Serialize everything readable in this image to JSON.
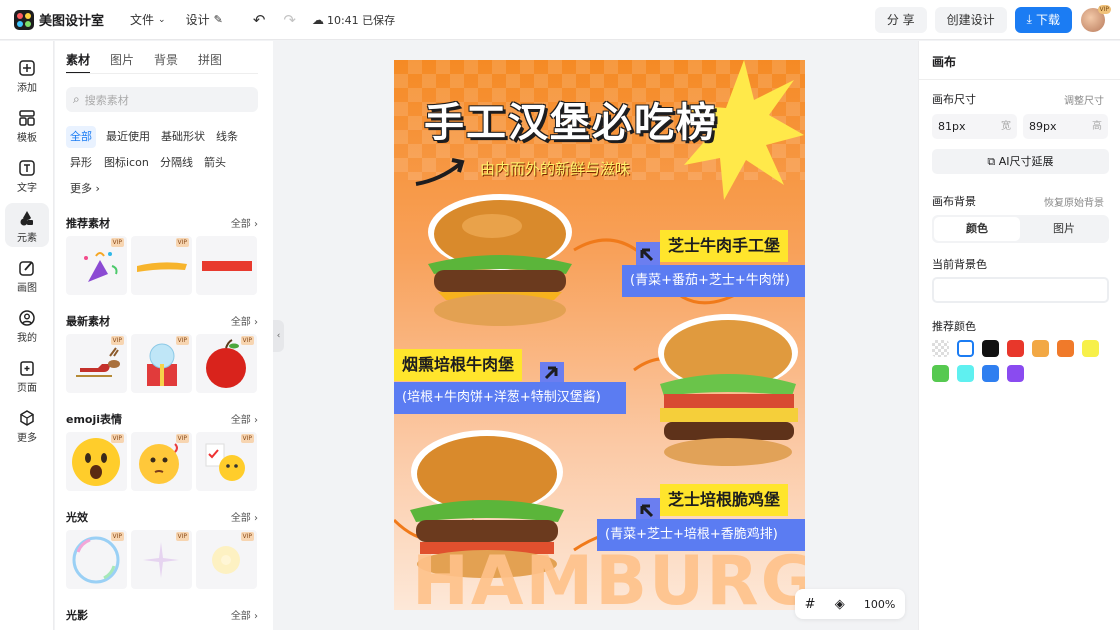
{
  "app": {
    "name": "美图设计室",
    "menu_file": "文件",
    "menu_design": "设计",
    "save_status": "10:41 已保存",
    "share": "分 享",
    "create": "创建设计",
    "download": "下载",
    "vip": "VIP"
  },
  "rail": [
    {
      "label": "添加"
    },
    {
      "label": "模板"
    },
    {
      "label": "文字"
    },
    {
      "label": "元素"
    },
    {
      "label": "画图"
    },
    {
      "label": "我的"
    },
    {
      "label": "页面"
    },
    {
      "label": "更多"
    }
  ],
  "panel": {
    "tabs": [
      "素材",
      "图片",
      "背景",
      "拼图"
    ],
    "search_placeholder": "搜索素材",
    "chips": [
      "全部",
      "最近使用",
      "基础形状",
      "线条",
      "异形",
      "图标icon",
      "分隔线",
      "箭头",
      "更多"
    ],
    "sections": [
      {
        "title": "推荐素材",
        "all": "全部"
      },
      {
        "title": "最新素材",
        "all": "全部"
      },
      {
        "title": "emoji表情",
        "all": "全部"
      },
      {
        "title": "光效",
        "all": "全部"
      },
      {
        "title": "光影",
        "all": "全部"
      }
    ],
    "vip": "VIP"
  },
  "poster": {
    "title": "手工汉堡必吃榜",
    "subtitle": "由内而外的新鲜与滋味",
    "item1_name": "芝士牛肉手工堡",
    "item1_desc": "(青菜+番茄+芝士+牛肉饼)",
    "item2_name": "烟熏培根牛肉堡",
    "item2_desc": "(培根+牛肉饼+洋葱+特制汉堡酱)",
    "item3_name": "芝士培根脆鸡堡",
    "item3_desc": "(青菜+芝士+培根+香脆鸡排)",
    "bg_word": "HAMBURG"
  },
  "zoom": {
    "level": "100%"
  },
  "right": {
    "title": "画布",
    "size_label": "画布尺寸",
    "adjust_size": "调整尺寸",
    "width_value": "81px",
    "width_unit": "宽",
    "height_value": "89px",
    "height_unit": "高",
    "ai_extend": "AI尺寸延展",
    "bg_label": "画布背景",
    "restore_bg": "恢复原始背景",
    "seg_color": "颜色",
    "seg_image": "图片",
    "current_bg": "当前背景色",
    "recommend": "推荐颜色",
    "swatches": [
      "#ffffff",
      "#111111",
      "#e8372b",
      "#f2a844",
      "#f07a2a",
      "#f7f04a",
      "#56c950",
      "#5ff0f0",
      "#2f7ff0",
      "#8a4bf0"
    ]
  }
}
